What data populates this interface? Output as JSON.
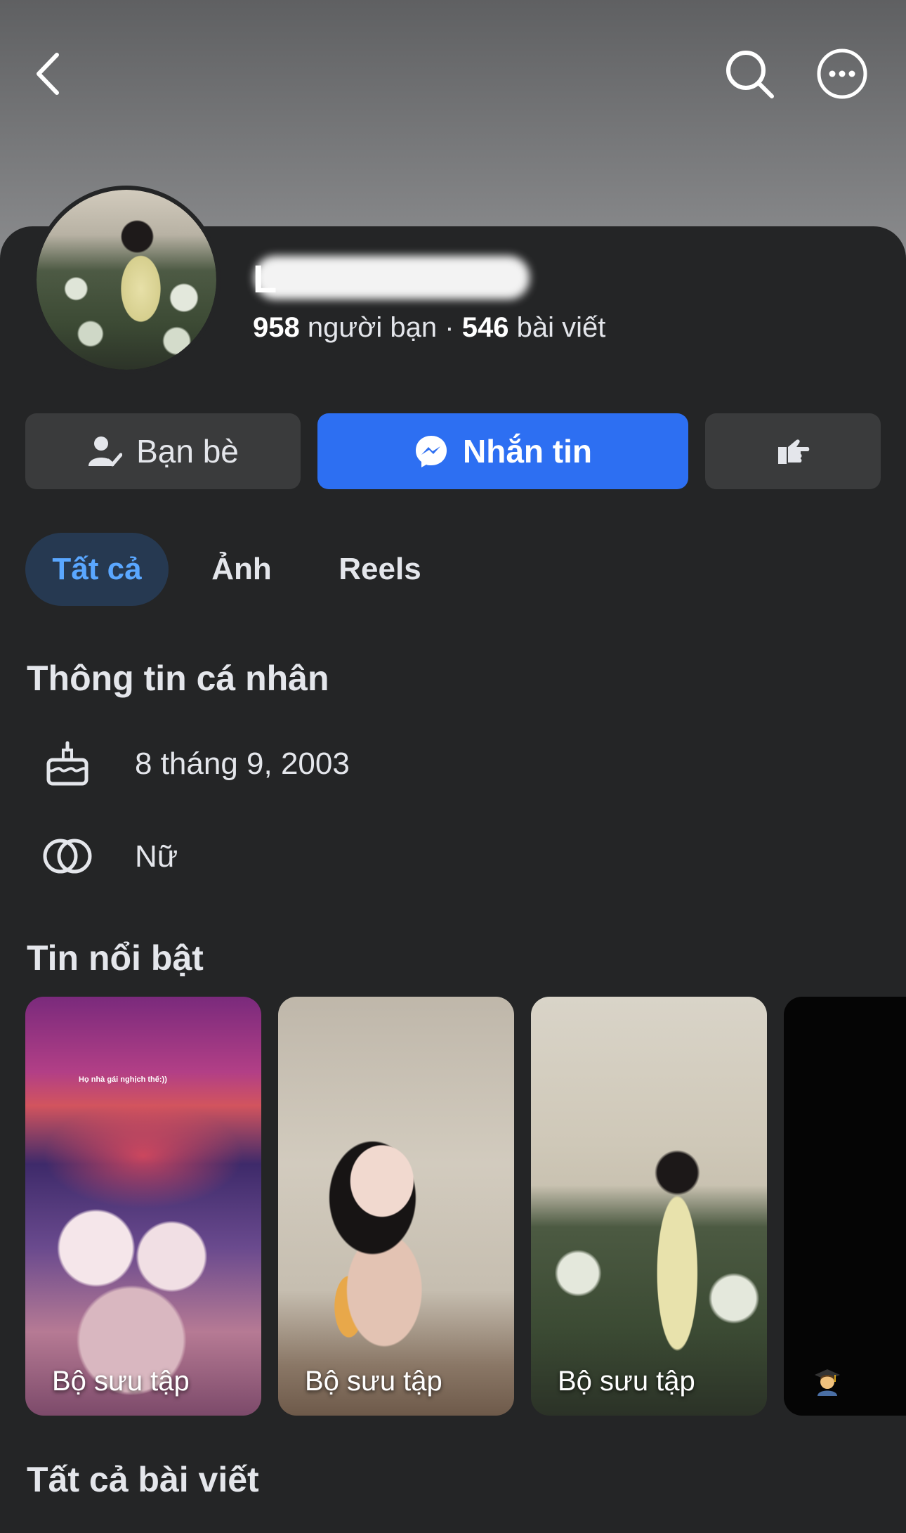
{
  "profile": {
    "name_initial": "L",
    "friends_count": "958",
    "friends_label": "người bạn",
    "separator": "·",
    "posts_count": "546",
    "posts_label": "bài viết"
  },
  "actions": {
    "friends_label": "Bạn bè",
    "message_label": "Nhắn tin"
  },
  "tabs": [
    {
      "label": "Tất cả",
      "active": true
    },
    {
      "label": "Ảnh",
      "active": false
    },
    {
      "label": "Reels",
      "active": false
    }
  ],
  "intro": {
    "title": "Thông tin cá nhân",
    "birthday": "8 tháng 9, 2003",
    "gender": "Nữ"
  },
  "highlights": {
    "title": "Tin nổi bật",
    "items": [
      {
        "label": "Bộ sưu tập",
        "caption": "Họ nhà gái nghịch thế:))"
      },
      {
        "label": "Bộ sưu tập"
      },
      {
        "label": "Bộ sưu tập"
      },
      {
        "label": "",
        "icon": "student-emoji"
      }
    ]
  },
  "posts": {
    "title": "Tất cả bài viết"
  },
  "colors": {
    "background": "#242526",
    "accent": "#2d6ff2",
    "active_tab_text": "#5aa7ff"
  },
  "icons": [
    "back-arrow-icon",
    "search-icon",
    "more-icon",
    "friend-check-icon",
    "messenger-icon",
    "poke-icon",
    "birthday-cake-icon",
    "gender-rings-icon"
  ]
}
